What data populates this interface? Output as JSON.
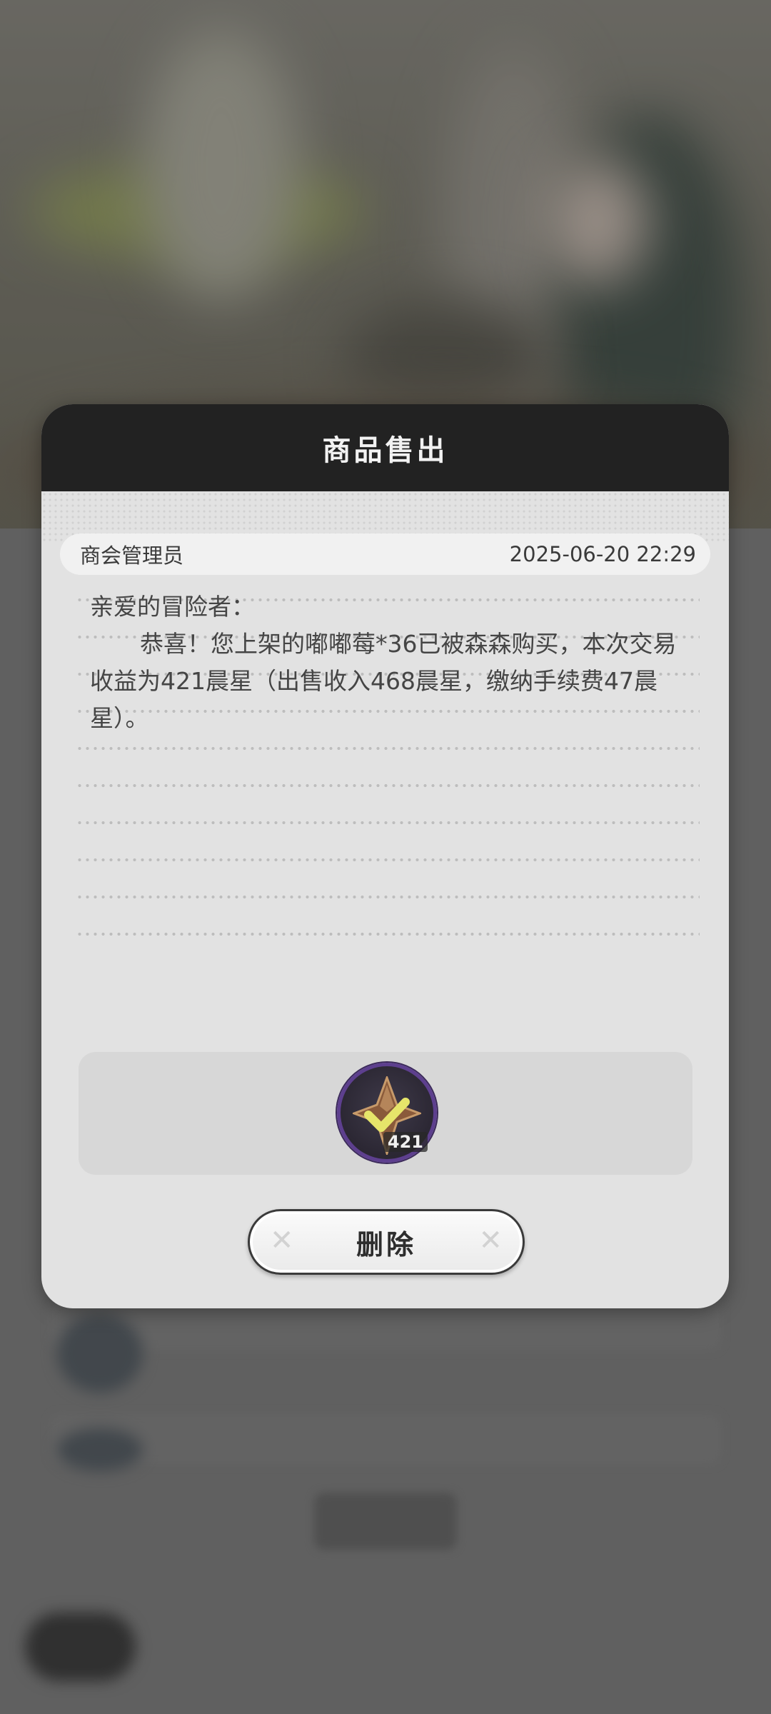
{
  "dialog": {
    "title": "商品售出",
    "sender": "商会管理员",
    "time": "2025-06-20 22:29",
    "greeting": "亲爱的冒险者：",
    "message": "恭喜！您上架的嘟嘟莓*36已被森森购买，本次交易收益为421晨星（出售收入468晨星，缴纳手续费47晨星）。",
    "reward": {
      "icon": "morning-star-currency-icon",
      "count": "421"
    },
    "delete_label": "删除"
  },
  "colors": {
    "header_bg": "#222222",
    "dialog_bg": "#e2e2e2",
    "reward_ring": "#5d3f8e"
  }
}
